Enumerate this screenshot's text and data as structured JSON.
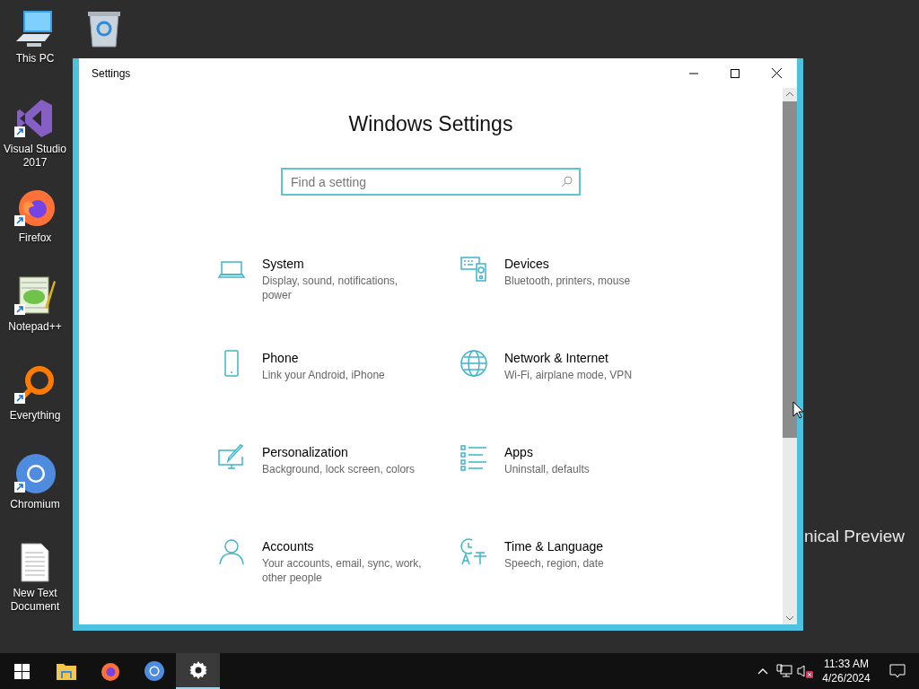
{
  "desktop": {
    "icons": [
      {
        "label": "This PC"
      },
      {
        "label": "Visual Studio 2017"
      },
      {
        "label": "Firefox"
      },
      {
        "label": "Notepad++"
      },
      {
        "label": "Everything"
      },
      {
        "label": "Chromium"
      },
      {
        "label": "New Text Document"
      }
    ],
    "watermark": "nical Preview"
  },
  "window": {
    "title": "Settings",
    "heading": "Windows Settings",
    "search": {
      "placeholder": "Find a setting"
    },
    "categories": [
      {
        "title": "System",
        "description": "Display, sound, notifications, power"
      },
      {
        "title": "Devices",
        "description": "Bluetooth, printers, mouse"
      },
      {
        "title": "Phone",
        "description": "Link your Android, iPhone"
      },
      {
        "title": "Network & Internet",
        "description": "Wi-Fi, airplane mode, VPN"
      },
      {
        "title": "Personalization",
        "description": "Background, lock screen, colors"
      },
      {
        "title": "Apps",
        "description": "Uninstall, defaults"
      },
      {
        "title": "Accounts",
        "description": "Your accounts, email, sync, work, other people"
      },
      {
        "title": "Time & Language",
        "description": "Speech, region, date"
      }
    ]
  },
  "taskbar": {
    "apps": [
      {
        "selected": false
      },
      {
        "selected": false
      },
      {
        "selected": false
      },
      {
        "selected": true
      }
    ],
    "time": "11:33 AM",
    "date": "4/26/2024"
  }
}
